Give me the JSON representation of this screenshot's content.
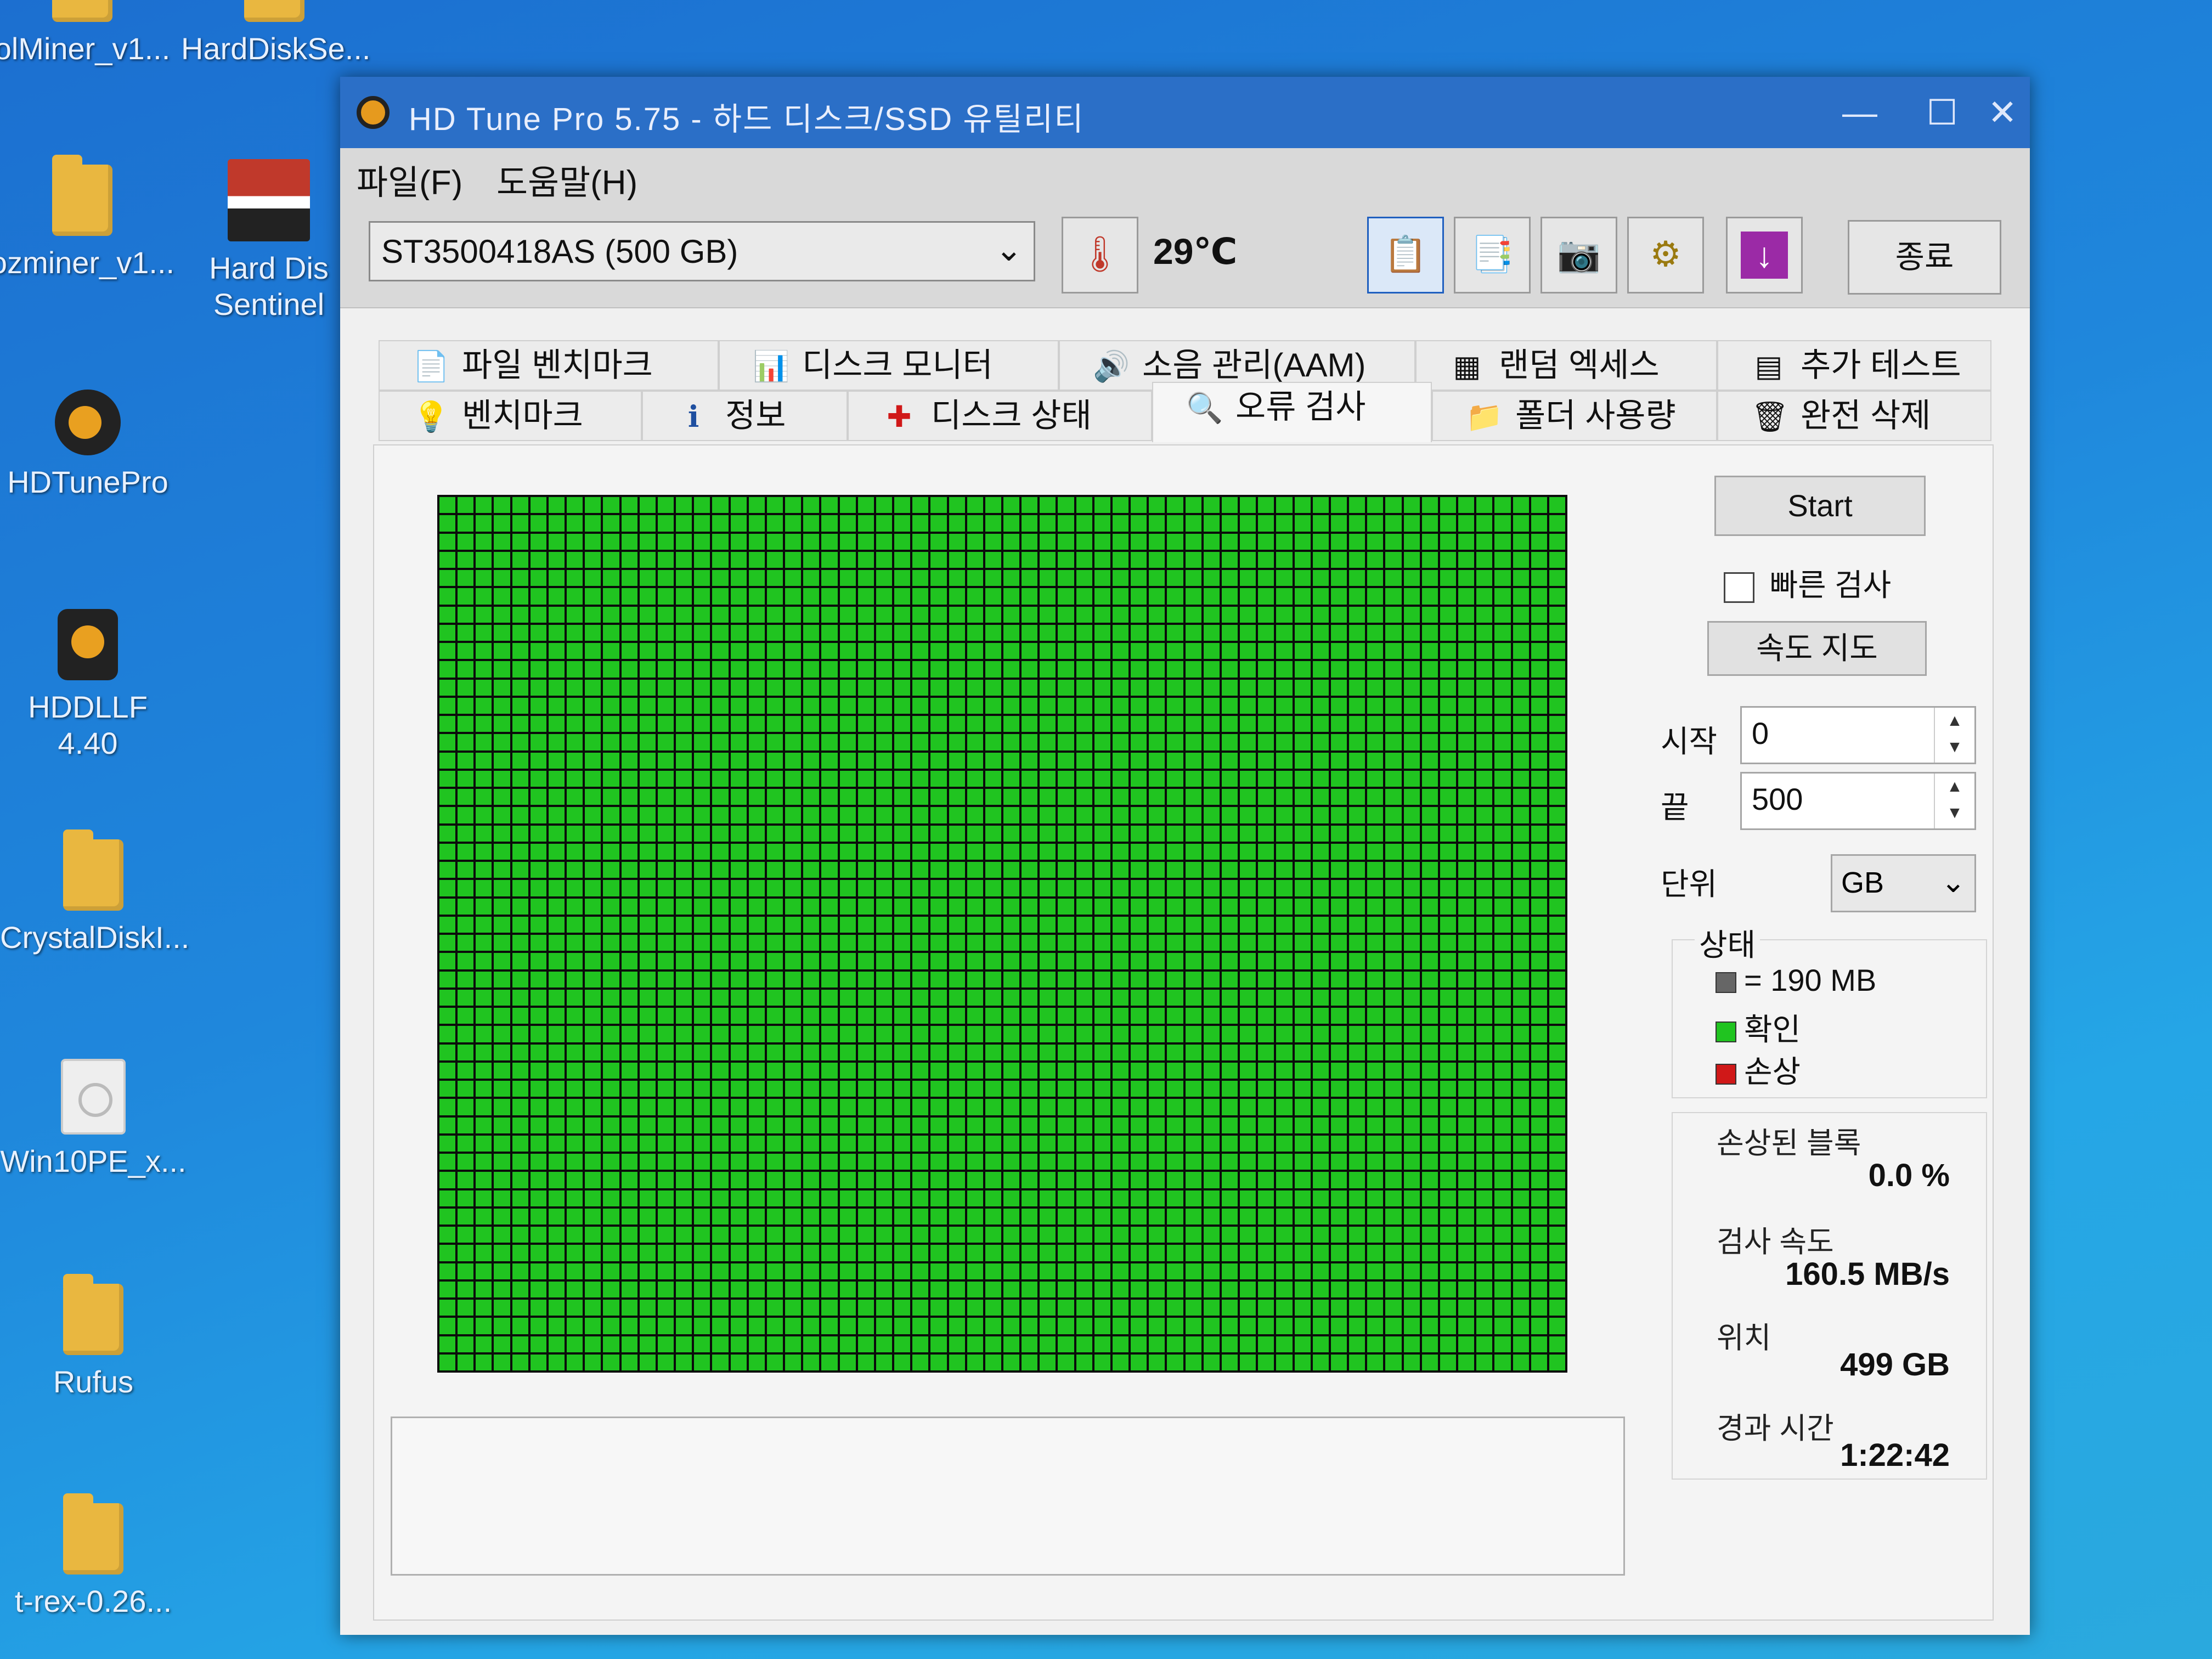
{
  "desktop": {
    "icons": [
      {
        "label": "olMiner_v1..."
      },
      {
        "label": "HardDiskSe..."
      },
      {
        "label": "ozminer_v1..."
      },
      {
        "label": "Hard Dis Sentinel"
      },
      {
        "label": "HDTunePro"
      },
      {
        "label": "HDDLLF 4.40"
      },
      {
        "label": "CrystalDiskI..."
      },
      {
        "label": "Win10PE_x..."
      },
      {
        "label": "Rufus"
      },
      {
        "label": "t-rex-0.26..."
      }
    ]
  },
  "window": {
    "title": "HD Tune Pro 5.75 - 하드 디스크/SSD 유틸리티",
    "minimize": "—",
    "maximize": "☐",
    "close": "✕"
  },
  "menu": {
    "file": "파일(F)",
    "help": "도움말(H)"
  },
  "toolbar": {
    "drive": "ST3500418AS (500 GB)",
    "temperature": "29℃",
    "exit_label": "종료"
  },
  "tabs": {
    "row1": [
      {
        "label": "파일 벤치마크",
        "icon": "file-benchmark-icon"
      },
      {
        "label": "디스크 모니터",
        "icon": "disk-monitor-icon"
      },
      {
        "label": "소음 관리(AAM)",
        "icon": "speaker-icon"
      },
      {
        "label": "랜덤 엑세스",
        "icon": "random-access-icon"
      },
      {
        "label": "추가 테스트",
        "icon": "extra-tests-icon"
      }
    ],
    "row2": [
      {
        "label": "벤치마크",
        "icon": "lightbulb-icon"
      },
      {
        "label": "정보",
        "icon": "info-icon"
      },
      {
        "label": "디스크 상태",
        "icon": "health-cross-icon"
      },
      {
        "label": "오류 검사",
        "icon": "magnifier-icon",
        "active": true
      },
      {
        "label": "폴더 사용량",
        "icon": "folder-icon"
      },
      {
        "label": "완전 삭제",
        "icon": "trash-icon"
      }
    ]
  },
  "error_scan": {
    "start_label": "Start",
    "quick_scan_label": "빠른 검사",
    "quick_scan_checked": false,
    "speed_map_label": "속도 지도",
    "start_field_label": "시작",
    "start_value": "0",
    "end_field_label": "끝",
    "end_value": "500",
    "unit_label": "단위",
    "unit_value": "GB",
    "legend_title": "상태",
    "legend": [
      {
        "label": "= 190 MB",
        "color": "#666666"
      },
      {
        "label": "확인",
        "color": "#20c420"
      },
      {
        "label": "손상",
        "color": "#d01818"
      }
    ],
    "damaged_blocks_label": "손상된 블록",
    "damaged_blocks_value": "0.0 %",
    "scan_speed_label": "검사 속도",
    "scan_speed_value": "160.5 MB/s",
    "position_label": "위치",
    "position_value": "499 GB",
    "elapsed_label": "경과 시간",
    "elapsed_value": "1:22:42",
    "block_color_ok": "#20c420"
  }
}
